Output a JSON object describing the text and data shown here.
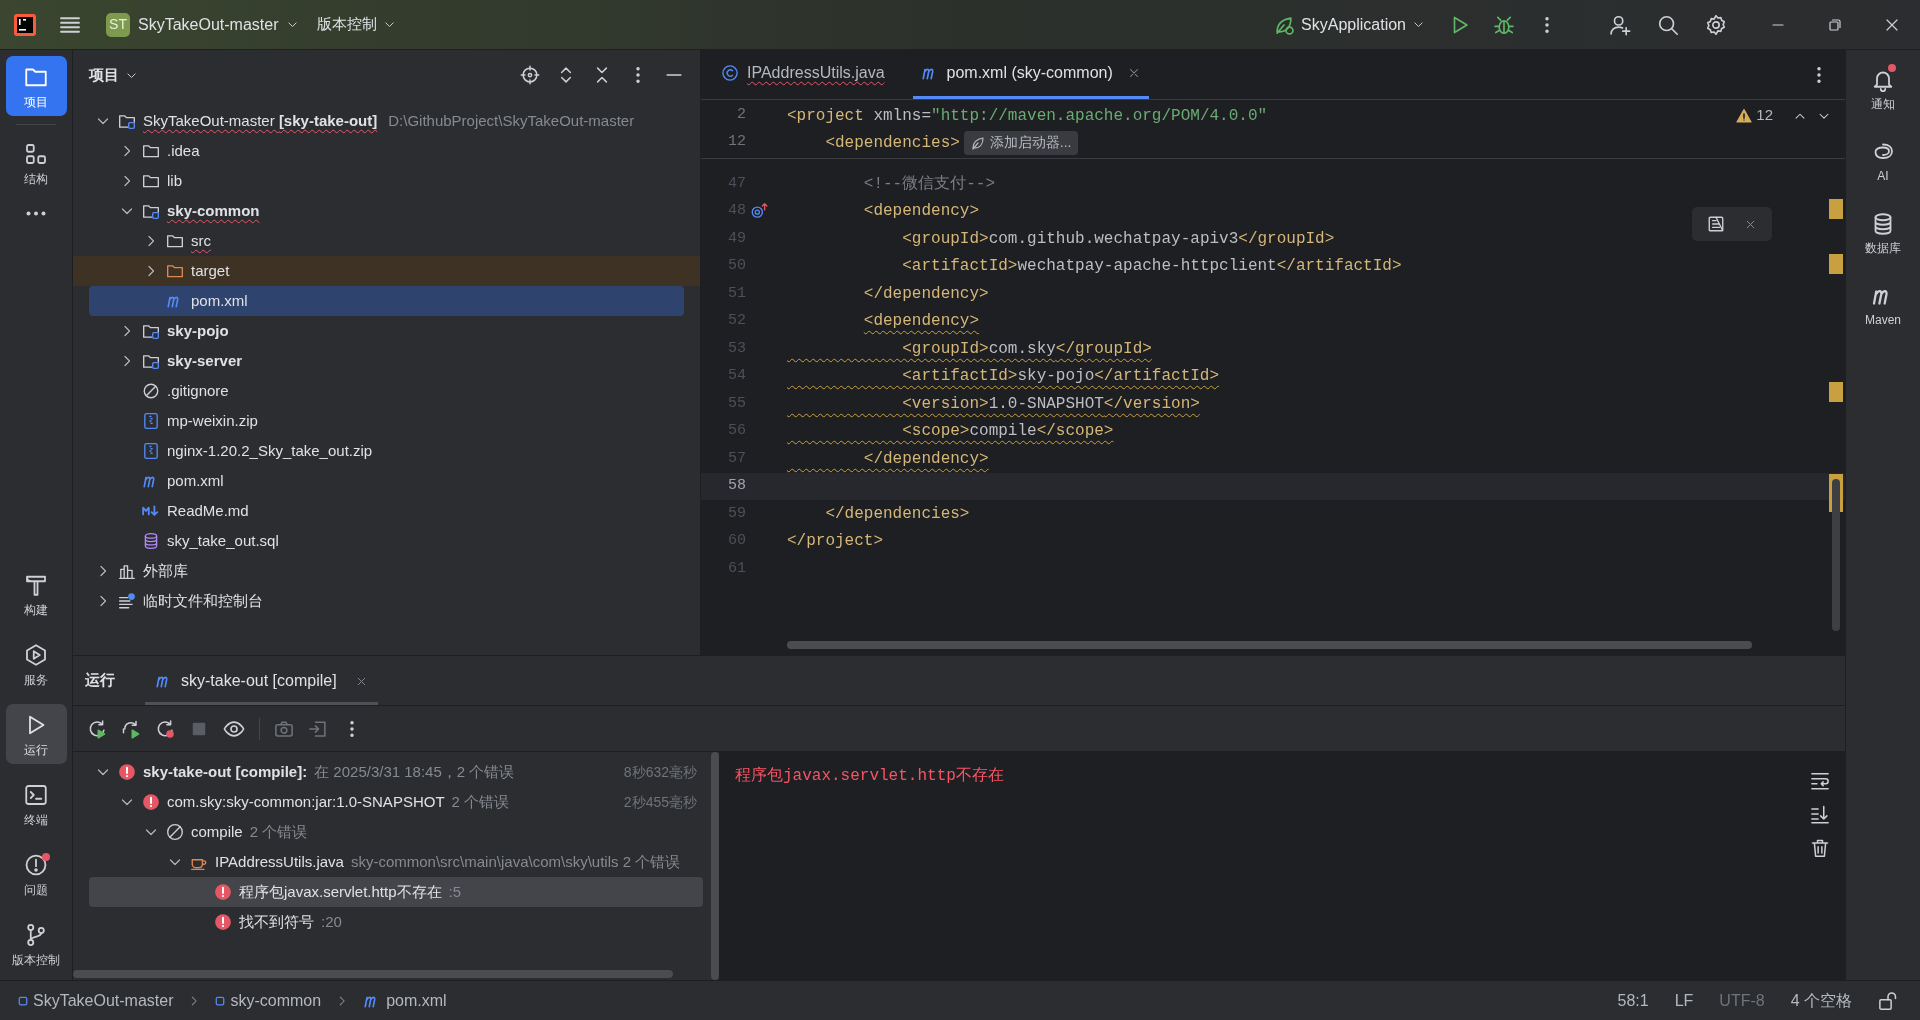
{
  "title_bar": {
    "project_badge": "ST",
    "project": "SkyTakeOut-master",
    "vcs": "版本控制",
    "run_config": "SkyApplication"
  },
  "left_toolbar": {
    "top": [
      {
        "label": "项目",
        "kind": "folder",
        "selected": true
      },
      {
        "label": "结构",
        "kind": "structure",
        "selected": false
      },
      {
        "kind": "more",
        "selected": false
      }
    ],
    "bottom": [
      {
        "label": "构建",
        "kind": "hammer",
        "selected": false,
        "badge": false
      },
      {
        "label": "服务",
        "kind": "services",
        "selected": false,
        "badge": false
      },
      {
        "label": "运行",
        "kind": "run",
        "selected": true,
        "badge": false
      },
      {
        "label": "终端",
        "kind": "terminal",
        "selected": false,
        "badge": false
      },
      {
        "label": "问题",
        "kind": "problems",
        "selected": false,
        "badge": true
      },
      {
        "label": "版本控制",
        "kind": "vcs",
        "selected": false,
        "badge": false
      }
    ]
  },
  "project_panel": {
    "title": "项目",
    "tree": [
      {
        "label": "SkyTakeOut-master **[sky-take-out]**",
        "location": "D:\\GithubProject\\SkyTakeOut-master",
        "kind": "project",
        "expanded": true,
        "selected": false,
        "excluded": false,
        "typo": true,
        "children": [
          {
            "label": ".idea",
            "kind": "folder",
            "expanded": false,
            "selected": false,
            "excluded": false,
            "typo": false
          },
          {
            "label": "lib",
            "kind": "folder",
            "expanded": false,
            "selected": false,
            "excluded": false,
            "typo": false
          },
          {
            "label": "sky-common",
            "kind": "module",
            "expanded": true,
            "selected": false,
            "excluded": false,
            "typo": true,
            "children": [
              {
                "label": "src",
                "kind": "folder",
                "expanded": false,
                "selected": false,
                "excluded": false,
                "typo": true
              },
              {
                "label": "target",
                "kind": "folder",
                "expanded": false,
                "selected": false,
                "excluded": true,
                "typo": false
              },
              {
                "label": "pom.xml",
                "kind": "maven",
                "selected": true,
                "excluded": false,
                "typo": false
              }
            ]
          },
          {
            "label": "sky-pojo",
            "kind": "module",
            "expanded": false,
            "selected": false,
            "excluded": false,
            "typo": false
          },
          {
            "label": "sky-server",
            "kind": "module",
            "expanded": false,
            "selected": false,
            "excluded": false,
            "typo": false
          },
          {
            "label": ".gitignore",
            "kind": "ignore",
            "selected": false,
            "excluded": false,
            "typo": false
          },
          {
            "label": "mp-weixin.zip",
            "kind": "zip",
            "selected": false,
            "excluded": false,
            "typo": false
          },
          {
            "label": "nginx-1.20.2_Sky_take_out.zip",
            "kind": "zip",
            "selected": false,
            "excluded": false,
            "typo": false
          },
          {
            "label": "pom.xml",
            "kind": "maven",
            "selected": false,
            "excluded": false,
            "typo": false
          },
          {
            "label": "ReadMe.md",
            "kind": "markdown",
            "selected": false,
            "excluded": false,
            "typo": false
          },
          {
            "label": "sky_take_out.sql",
            "kind": "database",
            "selected": false,
            "excluded": false,
            "typo": false
          }
        ]
      },
      {
        "label": "外部库",
        "kind": "library",
        "expanded": false,
        "selected": false,
        "excluded": false,
        "typo": false
      },
      {
        "label": "临时文件和控制台",
        "kind": "scratches",
        "expanded": false,
        "selected": false,
        "excluded": false,
        "typo": false
      }
    ]
  },
  "editor": {
    "tabs": [
      {
        "label": "IPAddressUtils.java",
        "kind": "class",
        "selected": false,
        "error": true
      },
      {
        "label": "pom.xml (sky-common)",
        "kind": "maven",
        "selected": true,
        "error": false
      }
    ],
    "warnings": "12",
    "launcher_hint": "添加启动器...",
    "sticky_lines": [
      {
        "number": "2",
        "segments": [
          {
            "kind": "tag",
            "text": "<project"
          },
          {
            "kind": "text",
            "text": " xmlns="
          },
          {
            "kind": "string",
            "text": "\"http://maven.apache.org/POM/4.0.0\""
          }
        ]
      },
      {
        "number": "12",
        "segments": [
          {
            "kind": "tag",
            "text": "    <dependencies>"
          }
        ]
      }
    ],
    "lines": [
      {
        "number": "47",
        "gutter_mark": false,
        "warning": false,
        "current": false,
        "segments": [
          {
            "kind": "comment",
            "text": "        <!--微信支付-->"
          }
        ]
      },
      {
        "number": "48",
        "gutter_mark": true,
        "warning": false,
        "current": false,
        "segments": [
          {
            "kind": "tag",
            "text": "        <dependency>"
          }
        ]
      },
      {
        "number": "49",
        "gutter_mark": false,
        "warning": false,
        "current": false,
        "segments": [
          {
            "kind": "tag",
            "text": "            <groupId>"
          },
          {
            "kind": "text",
            "text": "com.github.wechatpay-apiv3"
          },
          {
            "kind": "tag",
            "text": "</groupId>"
          }
        ]
      },
      {
        "number": "50",
        "gutter_mark": false,
        "warning": false,
        "current": false,
        "segments": [
          {
            "kind": "tag",
            "text": "            <artifactId>"
          },
          {
            "kind": "text",
            "text": "wechatpay-apache-httpclient"
          },
          {
            "kind": "tag",
            "text": "</artifactId>"
          }
        ]
      },
      {
        "number": "51",
        "gutter_mark": false,
        "warning": false,
        "current": false,
        "segments": [
          {
            "kind": "tag",
            "text": "        </dependency>"
          }
        ]
      },
      {
        "number": "52",
        "gutter_mark": false,
        "warning": true,
        "current": false,
        "segments": [
          {
            "kind": "tag",
            "text": "        <dependency>"
          }
        ]
      },
      {
        "number": "53",
        "gutter_mark": false,
        "warning": true,
        "current": false,
        "segments": [
          {
            "kind": "tag",
            "text": "            <groupId>"
          },
          {
            "kind": "text",
            "text": "com.sky"
          },
          {
            "kind": "tag",
            "text": "</groupId>"
          }
        ]
      },
      {
        "number": "54",
        "gutter_mark": false,
        "warning": true,
        "current": false,
        "segments": [
          {
            "kind": "tag",
            "text": "            <artifactId>"
          },
          {
            "kind": "text",
            "text": "sky-pojo"
          },
          {
            "kind": "tag",
            "text": "</artifactId>"
          }
        ]
      },
      {
        "number": "55",
        "gutter_mark": false,
        "warning": true,
        "current": false,
        "segments": [
          {
            "kind": "tag",
            "text": "            <version>"
          },
          {
            "kind": "text",
            "text": "1.0-SNAPSHOT"
          },
          {
            "kind": "tag",
            "text": "</version>"
          }
        ]
      },
      {
        "number": "56",
        "gutter_mark": false,
        "warning": true,
        "current": false,
        "segments": [
          {
            "kind": "tag",
            "text": "            <scope>"
          },
          {
            "kind": "text",
            "text": "compile"
          },
          {
            "kind": "tag",
            "text": "</scope>"
          }
        ]
      },
      {
        "number": "57",
        "gutter_mark": false,
        "warning": true,
        "current": false,
        "segments": [
          {
            "kind": "tag",
            "text": "        </dependency>"
          }
        ]
      },
      {
        "number": "58",
        "gutter_mark": false,
        "warning": false,
        "current": true
      },
      {
        "number": "59",
        "gutter_mark": false,
        "warning": false,
        "current": false,
        "segments": [
          {
            "kind": "tag",
            "text": "    </dependencies>"
          }
        ]
      },
      {
        "number": "60",
        "gutter_mark": false,
        "warning": false,
        "current": false,
        "segments": [
          {
            "kind": "tag",
            "text": "</project>"
          }
        ]
      },
      {
        "number": "61",
        "gutter_mark": false,
        "warning": false,
        "current": false
      }
    ]
  },
  "run_panel": {
    "title": "运行",
    "tab": {
      "label": "sky-take-out [compile]",
      "selected": true
    },
    "build_tree": [
      {
        "label": "sky-take-out [compile]:",
        "detail": "在 2025/3/31 18:45，2 个错误",
        "duration": "8秒632毫秒",
        "kind": "error",
        "expanded": true,
        "selected": false,
        "children": [
          {
            "label": "com.sky:sky-common:jar:1.0-SNAPSHOT",
            "detail": "2 个错误",
            "duration": "2秒455毫秒",
            "kind": "error",
            "expanded": true,
            "selected": false,
            "children": [
              {
                "label": "compile",
                "detail": "2 个错误",
                "kind": "goal",
                "expanded": true,
                "selected": false,
                "children": [
                  {
                    "label": "IPAddressUtils.java",
                    "detail": "sky-common\\src\\main\\java\\com\\sky\\utils 2 个错误",
                    "kind": "file",
                    "expanded": true,
                    "selected": false,
                    "children": [
                      {
                        "label": "程序包javax.servlet.http不存在",
                        "detail": ":5",
                        "kind": "error",
                        "selected": true
                      },
                      {
                        "label": "找不到符号",
                        "detail": ":20",
                        "kind": "error",
                        "selected": false
                      }
                    ]
                  }
                ]
              }
            ]
          }
        ]
      }
    ],
    "console": [
      "程序包javax.servlet.http不存在"
    ]
  },
  "right_toolbar": [
    {
      "label": "通知",
      "kind": "bell",
      "badge": true
    },
    {
      "label": "AI",
      "kind": "ai",
      "badge": false
    },
    {
      "label": "数据库",
      "kind": "database",
      "badge": false
    },
    {
      "label": "Maven",
      "kind": "maven",
      "badge": false
    }
  ],
  "status_bar": {
    "breadcrumbs": [
      {
        "label": "SkyTakeOut-master",
        "kind": "module"
      },
      {
        "label": "sky-common",
        "kind": "module"
      },
      {
        "label": "pom.xml",
        "kind": "maven"
      }
    ],
    "position": "58:1",
    "line_separator": "LF",
    "encoding": "UTF-8",
    "indent": "4 个空格"
  }
}
